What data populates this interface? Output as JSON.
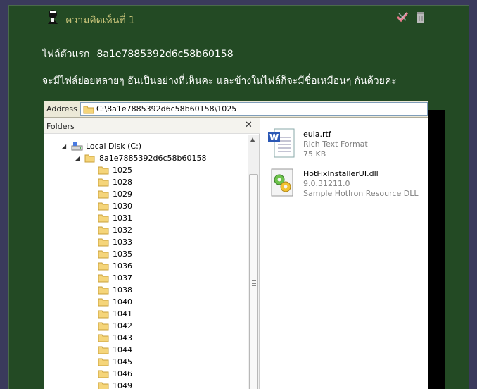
{
  "post": {
    "title": "ความคิดเห็นที่ 1",
    "line1_label": "ไฟล์ตัวแรก",
    "line1_hash": "8a1e7885392d6c58b60158",
    "line2": "จะมีไฟล์ย่อยหลายๆ อันเป็นอย่างที่เห็นคะ และข้างในไฟล์ก็จะมีชื่อเหมือนๆ กันด้วยคะ",
    "accent": "#c9c47a",
    "background": "#234a24"
  },
  "explorer": {
    "address_label": "Address",
    "address_value": "C:\\8a1e7885392d6c58b60158\\1025",
    "folders_label": "Folders",
    "close_label": "✕",
    "tree": {
      "drive": "Local Disk (C:)",
      "root": "8a1e7885392d6c58b60158",
      "folders": [
        "1025",
        "1028",
        "1029",
        "1030",
        "1031",
        "1032",
        "1033",
        "1035",
        "1036",
        "1037",
        "1038",
        "1040",
        "1041",
        "1042",
        "1043",
        "1044",
        "1045",
        "1046",
        "1049"
      ]
    },
    "files": [
      {
        "name": "eula.rtf",
        "type": "Rich Text Format",
        "size": "75 KB",
        "icon": "word-document-icon"
      },
      {
        "name": "HotFixInstallerUI.dll",
        "type": "9.0.31211.0",
        "size": "Sample HotIron Resource DLL",
        "icon": "dll-gear-icon"
      }
    ]
  }
}
